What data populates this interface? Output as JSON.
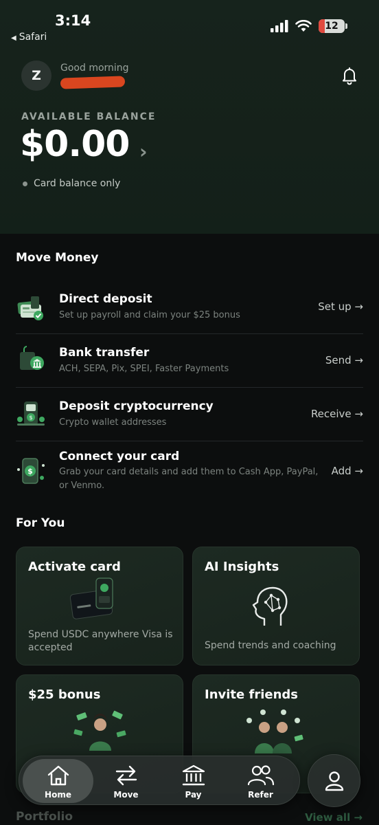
{
  "status_bar": {
    "time": "3:14",
    "back_app": "Safari",
    "battery": "12"
  },
  "header": {
    "avatar_initial": "Z",
    "greeting": "Good morning"
  },
  "balance": {
    "label": "AVAILABLE BALANCE",
    "amount": "$0.00",
    "chevron": "›",
    "note": "Card balance only"
  },
  "move_money": {
    "title": "Move Money",
    "items": [
      {
        "title": "Direct deposit",
        "subtitle": "Set up payroll and claim your $25 bonus",
        "action": "Set up →",
        "icon": "direct-deposit-icon"
      },
      {
        "title": "Bank transfer",
        "subtitle": "ACH, SEPA, Pix, SPEI, Faster Payments",
        "action": "Send →",
        "icon": "bank-transfer-icon"
      },
      {
        "title": "Deposit cryptocurrency",
        "subtitle": "Crypto wallet addresses",
        "action": "Receive →",
        "icon": "crypto-deposit-icon"
      },
      {
        "title": "Connect your card",
        "subtitle": "Grab your card details and add them to Cash App, PayPal, or Venmo.",
        "action": "Add →",
        "icon": "connect-card-icon"
      }
    ]
  },
  "for_you": {
    "title": "For You",
    "cards": [
      {
        "title": "Activate card",
        "subtitle": "Spend USDC anywhere Visa is accepted"
      },
      {
        "title": "AI Insights",
        "subtitle": "Spend trends and coaching"
      },
      {
        "title": "$25 bonus",
        "subtitle": ""
      },
      {
        "title": "Invite friends",
        "subtitle": ""
      }
    ]
  },
  "portfolio": {
    "title": "Portfolio",
    "view_all": "View all →"
  },
  "tabbar": {
    "tabs": [
      {
        "label": "Home",
        "icon": "home-icon",
        "active": true
      },
      {
        "label": "Move",
        "icon": "transfer-arrows-icon",
        "active": false
      },
      {
        "label": "Pay",
        "icon": "bank-icon",
        "active": false
      },
      {
        "label": "Refer",
        "icon": "users-icon",
        "active": false
      }
    ],
    "profile_icon": "profile-icon"
  },
  "colors": {
    "hero_bg": "#16231c",
    "page_bg": "#0c0e0e",
    "accent_green": "#3ea860",
    "redaction": "#d9461f"
  }
}
